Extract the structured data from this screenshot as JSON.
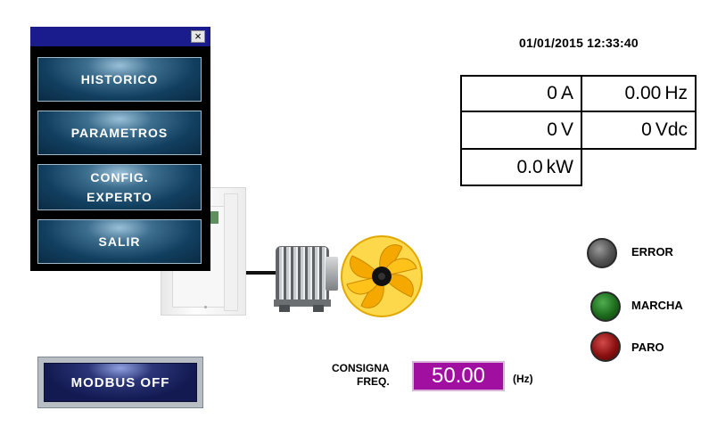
{
  "header": {
    "datetime": "01/01/2015 12:33:40"
  },
  "readings": [
    {
      "value": "0",
      "unit": "A"
    },
    {
      "value": "0.00",
      "unit": "Hz"
    },
    {
      "value": "0",
      "unit": "V"
    },
    {
      "value": "0",
      "unit": "Vdc"
    },
    {
      "value": "0.0",
      "unit": "kW"
    }
  ],
  "menu": {
    "close_label": "×",
    "items": [
      {
        "label": "HISTORICO"
      },
      {
        "label": "PARAMETROS"
      },
      {
        "label": "CONFIG.\nEXPERTO"
      },
      {
        "label": "SALIR"
      }
    ]
  },
  "modbus_button": {
    "label": "MODBUS OFF"
  },
  "indicators": [
    {
      "label": "ERROR",
      "color": "#555555"
    },
    {
      "label": "MARCHA",
      "color": "#1d6b1d"
    },
    {
      "label": "PARO",
      "color": "#8a1010"
    }
  ],
  "setpoint": {
    "label": "CONSIGNA\nFREQ.",
    "value": "50.00",
    "unit": "(Hz)"
  },
  "colors": {
    "menu_titlebar": "#1a1b8c",
    "setpoint_bg": "#a10fa1",
    "fan": "#f5b800"
  }
}
